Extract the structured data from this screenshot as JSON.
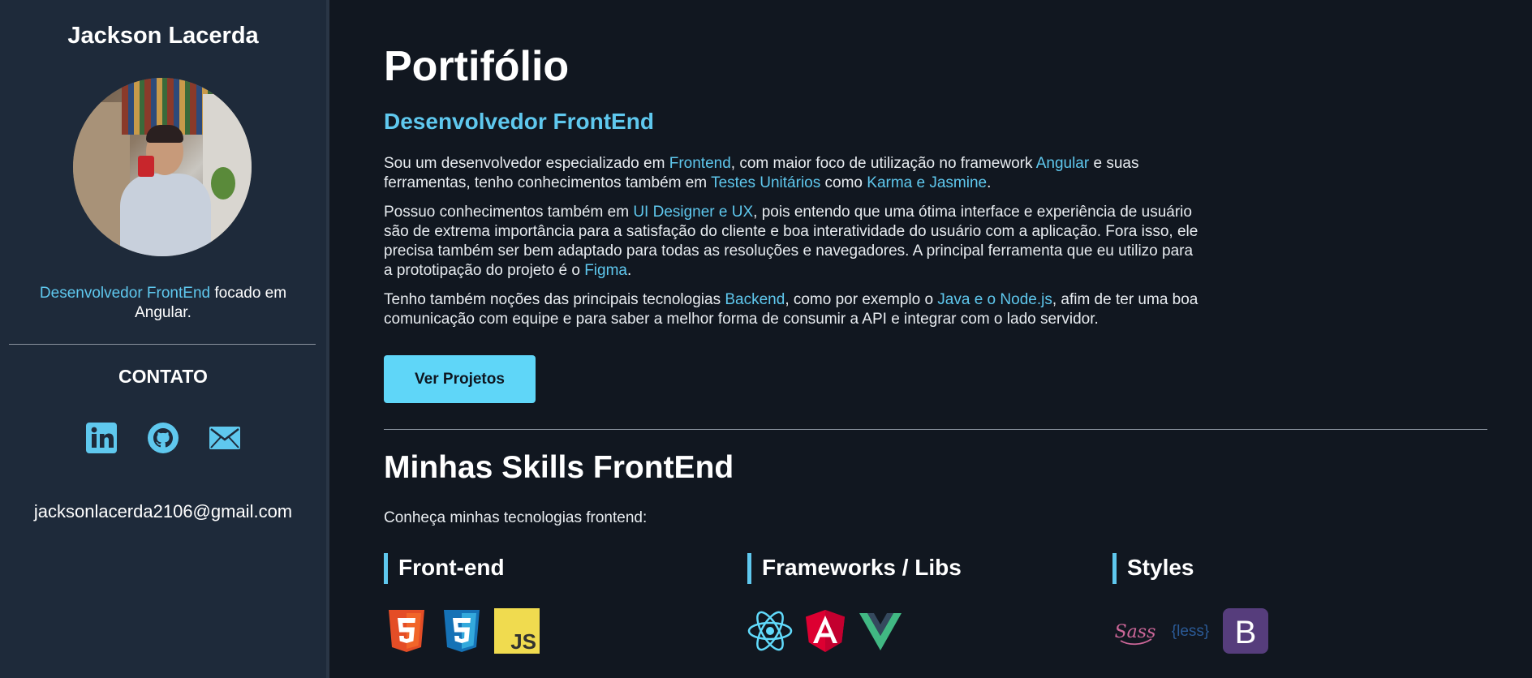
{
  "sidebar": {
    "name": "Jackson Lacerda",
    "role_highlight": "Desenvolvedor FrontEnd",
    "role_rest": " focado em Angular.",
    "contact_heading": "CONTATO",
    "social": [
      {
        "icon": "linkedin-icon"
      },
      {
        "icon": "github-icon"
      },
      {
        "icon": "mail-icon"
      }
    ],
    "email": "jacksonlacerda2106@gmail.com"
  },
  "main": {
    "title": "Portifólio",
    "subtitle": "Desenvolvedor FrontEnd",
    "p1": {
      "a": "Sou um desenvolvedor especializado em ",
      "b": "Frontend",
      "c": ", com maior foco de utilização no framework ",
      "d": "Angular",
      "e": " e suas ferramentas, tenho conhecimentos também em ",
      "f": "Testes Unitários",
      "g": " como ",
      "h": "Karma e Jasmine",
      "i": "."
    },
    "p2": {
      "a": "Possuo conhecimentos também em ",
      "b": "UI Designer e UX",
      "c": ", pois entendo que uma ótima interface e experiência de usuário são de extrema importância para a satisfação do cliente e boa interatividade do usuário com a aplicação. Fora isso, ele precisa também ser bem adaptado para todas as resoluções e navegadores. A principal ferramenta que eu utilizo para a prototipação do projeto é o ",
      "d": "Figma",
      "e": "."
    },
    "p3": {
      "a": "Tenho também noções das principais tecnologias ",
      "b": "Backend",
      "c": ", como por exemplo o ",
      "d": "Java e o Node.js",
      "e": ", afim de ter uma boa comunicação com equipe e para saber a melhor forma de consumir a API e integrar com o lado servidor."
    },
    "button_label": "Ver Projetos",
    "skills_title": "Minhas Skills FrontEnd",
    "skills_sub": "Conheça minhas tecnologias frontend:",
    "categories": [
      {
        "title": "Front-end",
        "icons": [
          "html5-icon",
          "css3-icon",
          "javascript-icon"
        ]
      },
      {
        "title": "Frameworks / Libs",
        "icons": [
          "react-icon",
          "angular-icon",
          "vue-icon"
        ]
      },
      {
        "title": "Styles",
        "icons": [
          "sass-icon",
          "less-icon",
          "bootstrap-icon"
        ]
      }
    ],
    "icon_text": {
      "js": "JS",
      "sass": "Sass",
      "less": "{less}",
      "bootstrap": "B"
    }
  },
  "colors": {
    "accent": "#5fc8ee",
    "button": "#5fd6f8",
    "sidebar_bg": "#1e2a3a",
    "page_bg": "#111720"
  }
}
